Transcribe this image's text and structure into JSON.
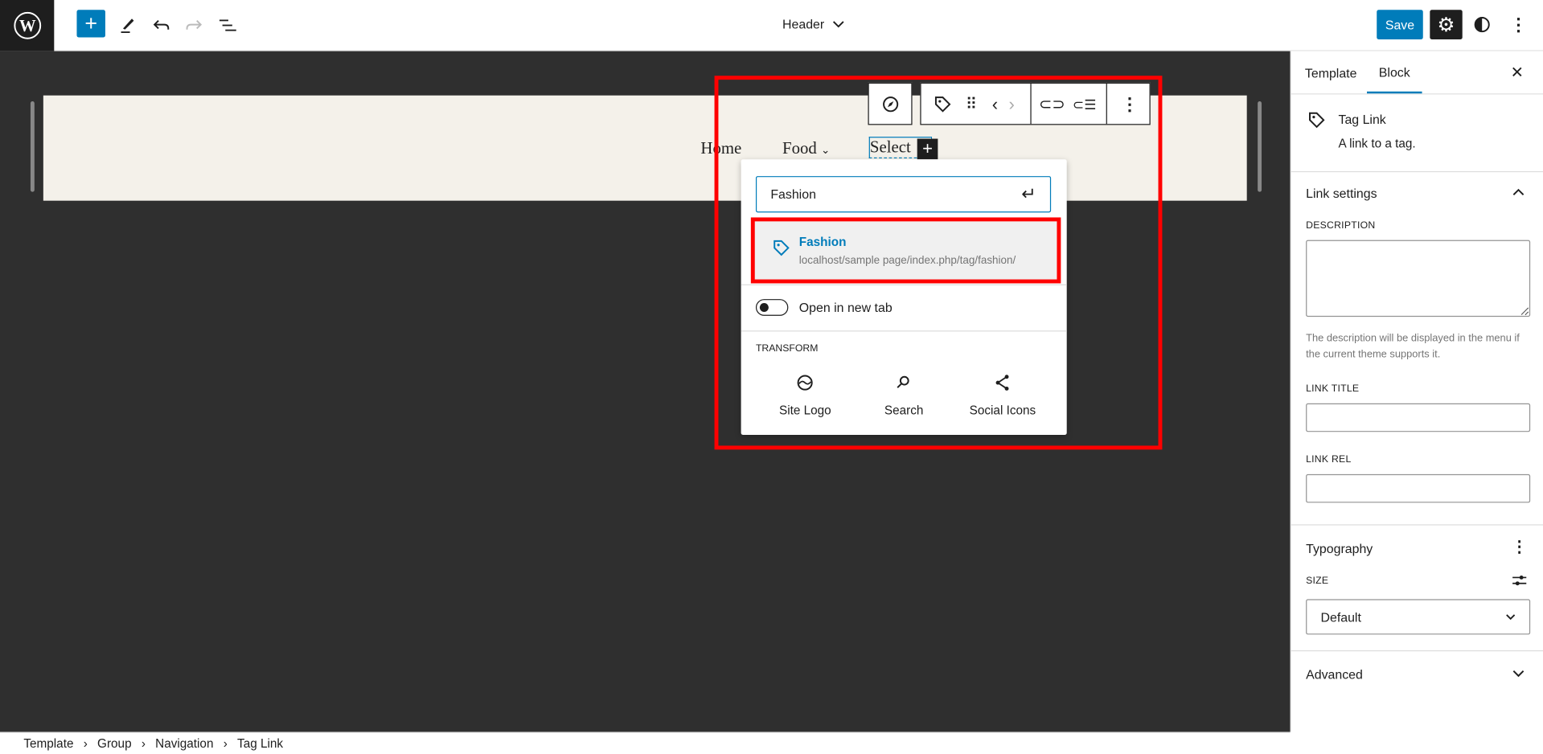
{
  "topbar": {
    "title": "Header",
    "save_label": "Save",
    "accent": "#007cba"
  },
  "canvas": {
    "nav_items": [
      "Home",
      "Food",
      "Select"
    ]
  },
  "link_popover": {
    "search_value": "Fashion",
    "result": {
      "title": "Fashion",
      "url": "localhost/sample page/index.php/tag/fashion/"
    },
    "open_new_tab_label": "Open in new tab",
    "open_new_tab_on": false,
    "transform_heading": "TRANSFORM",
    "transforms": [
      {
        "label": "Site Logo",
        "icon": "site-logo-icon"
      },
      {
        "label": "Search",
        "icon": "search-icon"
      },
      {
        "label": "Social Icons",
        "icon": "share-icon"
      }
    ]
  },
  "sidebar": {
    "tabs": [
      "Template",
      "Block"
    ],
    "active_tab": "Block",
    "block": {
      "title": "Tag Link",
      "description": "A link to a tag."
    },
    "link_settings": {
      "heading": "Link settings",
      "description_label": "DESCRIPTION",
      "description_value": "",
      "description_help": "The description will be displayed in the menu if the current theme supports it.",
      "link_title_label": "LINK TITLE",
      "link_title_value": "",
      "link_rel_label": "LINK REL",
      "link_rel_value": ""
    },
    "typography": {
      "heading": "Typography",
      "size_label": "SIZE",
      "size_value": "Default"
    },
    "advanced": {
      "heading": "Advanced"
    }
  },
  "breadcrumb": [
    "Template",
    "Group",
    "Navigation",
    "Tag Link"
  ]
}
